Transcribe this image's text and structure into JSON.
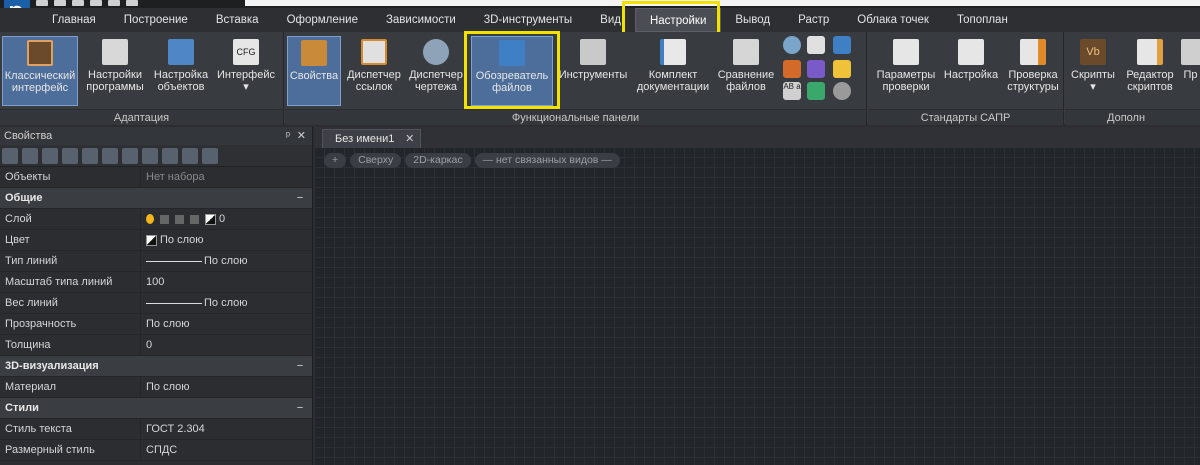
{
  "ribbon_tabs": [
    "Главная",
    "Построение",
    "Вставка",
    "Оформление",
    "Зависимости",
    "3D-инструменты",
    "Вид",
    "Настройки",
    "Вывод",
    "Растр",
    "Облака точек",
    "Топоплан"
  ],
  "active_tab": "Настройки",
  "groups": {
    "adaptation": {
      "title": "Адаптация",
      "buttons": [
        "Классический\nинтерфейс",
        "Настройки\nпрограммы",
        "Настройка\nобъектов",
        "Интерфейс\n▾"
      ]
    },
    "functional": {
      "title": "Функциональные панели",
      "buttons": [
        "Свойства",
        "Диспетчер\nссылок",
        "Диспетчер\nчертежа",
        "Обозреватель\nфайлов",
        "Инструменты",
        "Комплект\nдокументации",
        "Сравнение\nфайлов"
      ]
    },
    "cad_standards": {
      "title": "Стандарты САПР",
      "buttons": [
        "Параметры\nпроверки",
        "Настройка",
        "Проверка\nструктуры"
      ]
    },
    "extra": {
      "title": "Дополн",
      "buttons": [
        "Скрипты\n▾",
        "Редактор\nскриптов",
        "Пр"
      ]
    }
  },
  "properties_panel": {
    "title": "Свойства",
    "pin": "ᵖ",
    "close": "✕",
    "rows": [
      {
        "type": "row",
        "key": "Объекты",
        "value": "Нет набора",
        "muted": true
      },
      {
        "type": "head",
        "key": "Общие"
      },
      {
        "type": "row",
        "key": "Слой",
        "value": "0",
        "kind": "layer"
      },
      {
        "type": "row",
        "key": "Цвет",
        "value": "По слою",
        "kind": "color"
      },
      {
        "type": "row",
        "key": "Тип линий",
        "value": "По слою",
        "kind": "line"
      },
      {
        "type": "row",
        "key": "Масштаб типа линий",
        "value": "100"
      },
      {
        "type": "row",
        "key": "Вес линий",
        "value": "По слою",
        "kind": "line"
      },
      {
        "type": "row",
        "key": "Прозрачность",
        "value": "По слою"
      },
      {
        "type": "row",
        "key": "Толщина",
        "value": "0"
      },
      {
        "type": "head",
        "key": "3D-визуализация"
      },
      {
        "type": "row",
        "key": "Материал",
        "value": "По слою"
      },
      {
        "type": "head",
        "key": "Стили"
      },
      {
        "type": "row",
        "key": "Стиль текста",
        "value": "ГОСТ 2.304"
      },
      {
        "type": "row",
        "key": "Размерный стиль",
        "value": "СПДС"
      }
    ],
    "collapse_symbol": "−"
  },
  "document": {
    "tab_title": "Без имени1",
    "tab_close": "✕",
    "view_controls": [
      "+",
      "Сверху",
      "2D-каркас",
      "— нет связанных видов —"
    ]
  },
  "colors": {
    "highlight": "#f2e200",
    "selected_button": "#4d6d9a",
    "canvas": "#22262b"
  }
}
